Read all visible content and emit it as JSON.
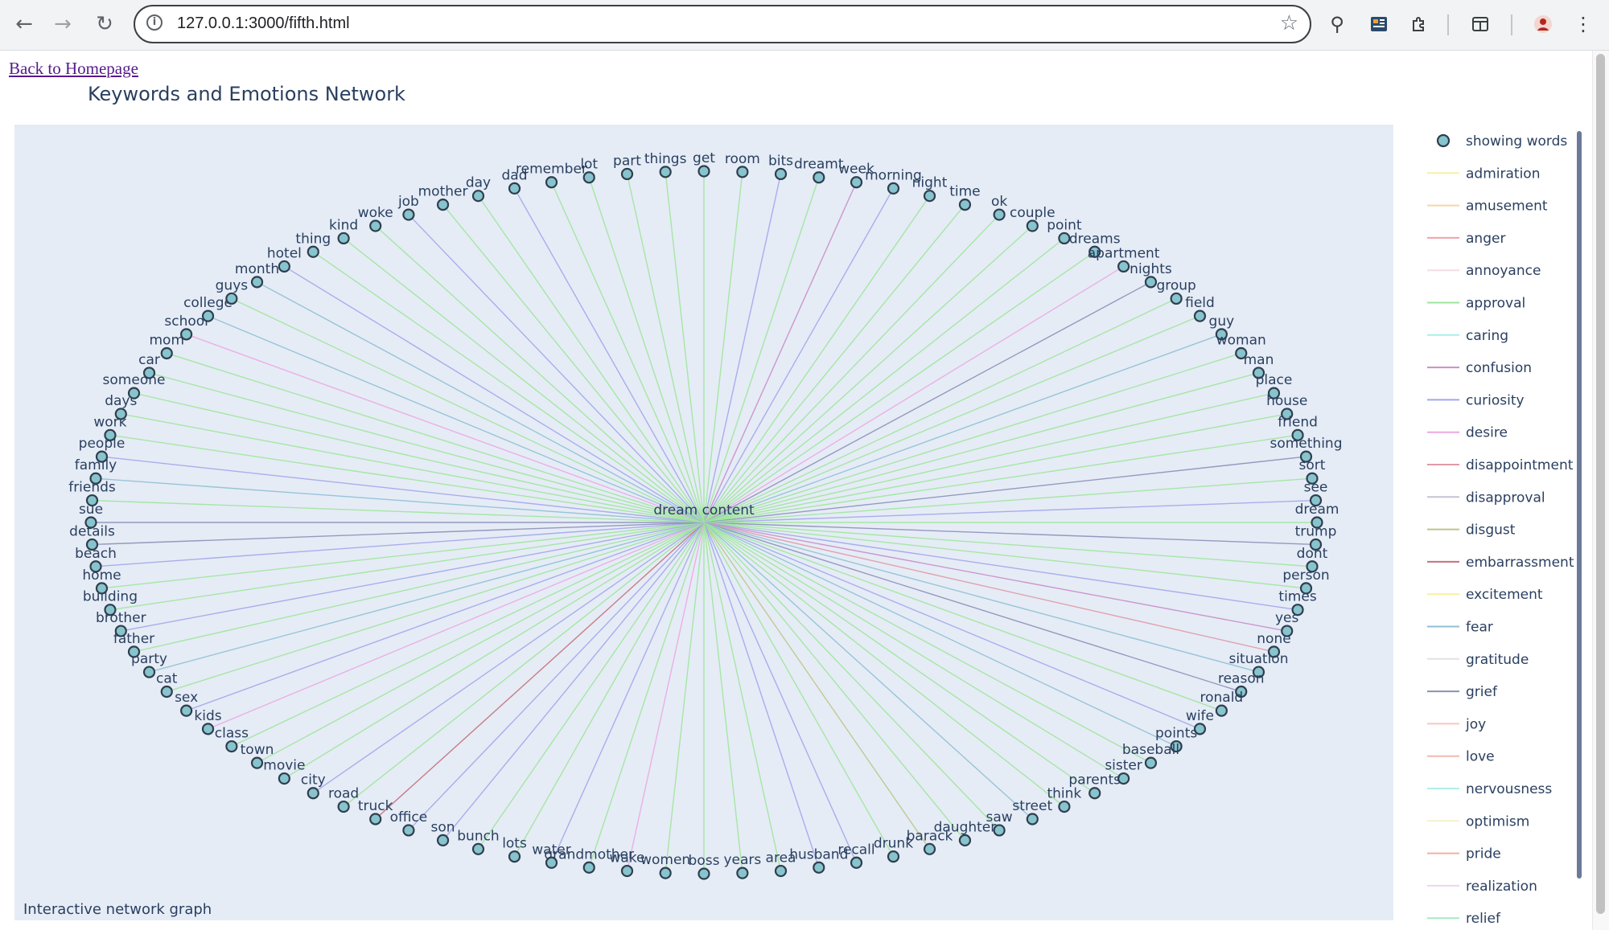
{
  "browser": {
    "url": "127.0.0.1:3000/fifth.html"
  },
  "page": {
    "back_link": "Back to Homepage",
    "title": "Keywords and Emotions Network",
    "footnote": "Interactive network graph",
    "center_label": "dream content"
  },
  "legend": {
    "nodes_label": "showing words",
    "items": [
      {
        "label": "admiration",
        "color": "#f7f0a6"
      },
      {
        "label": "amusement",
        "color": "#f5d7a0"
      },
      {
        "label": "anger",
        "color": "#f2a0a8"
      },
      {
        "label": "annoyance",
        "color": "#f3dde3"
      },
      {
        "label": "approval",
        "color": "#9ee59b"
      },
      {
        "label": "caring",
        "color": "#a8f0ea"
      },
      {
        "label": "confusion",
        "color": "#c98ec8"
      },
      {
        "label": "curiosity",
        "color": "#a3a6ea"
      },
      {
        "label": "desire",
        "color": "#eba8e4"
      },
      {
        "label": "disappointment",
        "color": "#e09aa6"
      },
      {
        "label": "disapproval",
        "color": "#c4c4d4"
      },
      {
        "label": "disgust",
        "color": "#bfc488"
      },
      {
        "label": "embarrassment",
        "color": "#c4707a"
      },
      {
        "label": "excitement",
        "color": "#f7f0a0"
      },
      {
        "label": "fear",
        "color": "#8fc0d4"
      },
      {
        "label": "gratitude",
        "color": "#e6e0e4"
      },
      {
        "label": "grief",
        "color": "#8c90b8"
      },
      {
        "label": "joy",
        "color": "#f6c8c0"
      },
      {
        "label": "love",
        "color": "#f4b8ae"
      },
      {
        "label": "nervousness",
        "color": "#b0eee8"
      },
      {
        "label": "optimism",
        "color": "#f5f2c8"
      },
      {
        "label": "pride",
        "color": "#f2b0a0"
      },
      {
        "label": "realization",
        "color": "#eed4ee"
      },
      {
        "label": "relief",
        "color": "#a8e8c8"
      }
    ]
  },
  "words": [
    "get",
    "room",
    "bits",
    "dreamt",
    "week",
    "morning",
    "night",
    "time",
    "ok",
    "couple",
    "point",
    "dreams",
    "apartment",
    "nights",
    "group",
    "field",
    "guy",
    "woman",
    "man",
    "place",
    "house",
    "friend",
    "something",
    "sort",
    "see",
    "dream",
    "trump",
    "dont",
    "person",
    "times",
    "yes",
    "none",
    "situation",
    "reason",
    "ronald",
    "wife",
    "points",
    "baseball",
    "sister",
    "parents",
    "think",
    "street",
    "saw",
    "daughter",
    "barack",
    "drunk",
    "recall",
    "husband",
    "area",
    "years",
    "boss",
    "women",
    "wake",
    "grandmother",
    "water",
    "lots",
    "bunch",
    "son",
    "office",
    "truck",
    "road",
    "city",
    "movie",
    "town",
    "class",
    "kids",
    "sex",
    "cat",
    "party",
    "father",
    "brother",
    "building",
    "home",
    "beach",
    "details",
    "sue",
    "friends",
    "family",
    "people",
    "work",
    "days",
    "someone",
    "car",
    "mom",
    "school",
    "college",
    "guys",
    "month",
    "hotel",
    "thing",
    "kind",
    "woke",
    "job",
    "mother",
    "day",
    "dad",
    "remember",
    "lot",
    "part",
    "things"
  ],
  "edge_emotions": [
    "approval",
    "approval",
    "curiosity",
    "approval",
    "confusion",
    "curiosity",
    "approval",
    "approval",
    "approval",
    "approval",
    "approval",
    "approval",
    "desire",
    "grief",
    "approval",
    "approval",
    "fear",
    "approval",
    "approval",
    "approval",
    "approval",
    "approval",
    "grief",
    "approval",
    "curiosity",
    "approval",
    "grief",
    "approval",
    "approval",
    "curiosity",
    "confusion",
    "disappointment",
    "fear",
    "grief",
    "approval",
    "curiosity",
    "fear",
    "approval",
    "approval",
    "approval",
    "approval",
    "fear",
    "approval",
    "approval",
    "disgust",
    "approval",
    "curiosity",
    "curiosity",
    "approval",
    "approval",
    "approval",
    "approval",
    "desire",
    "approval",
    "curiosity",
    "approval",
    "approval",
    "curiosity",
    "curiosity",
    "embarrassment",
    "approval",
    "curiosity",
    "approval",
    "approval",
    "approval",
    "desire",
    "curiosity",
    "approval",
    "fear",
    "approval",
    "curiosity",
    "approval",
    "approval",
    "curiosity",
    "grief",
    "grief",
    "approval",
    "fear",
    "curiosity",
    "approval",
    "approval",
    "approval",
    "approval",
    "approval",
    "desire",
    "fear",
    "approval",
    "fear",
    "curiosity",
    "approval",
    "approval",
    "approval",
    "curiosity",
    "approval",
    "approval",
    "curiosity",
    "approval",
    "approval",
    "approval",
    "approval"
  ]
}
